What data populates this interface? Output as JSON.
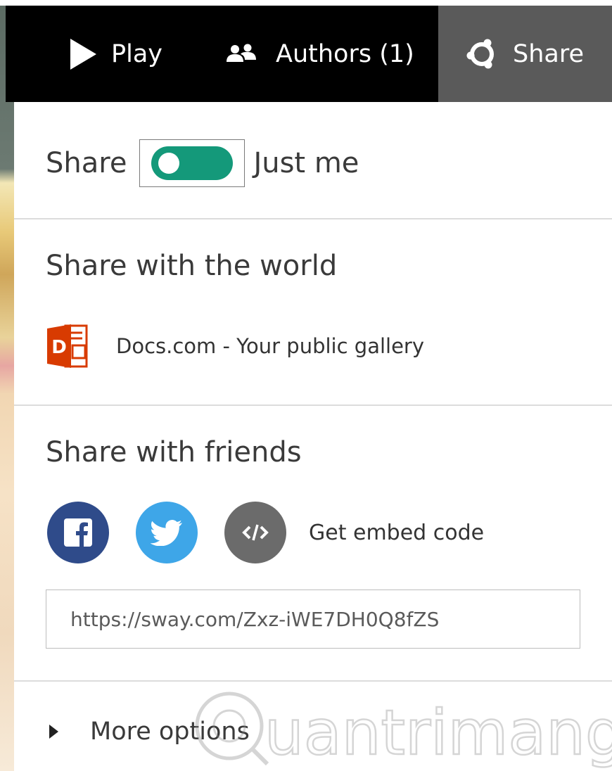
{
  "toolbar": {
    "play_label": "Play",
    "authors_label": "Authors (1)",
    "share_label": "Share"
  },
  "share_setting": {
    "label": "Share",
    "toggle_state": "off",
    "value_label": "Just me"
  },
  "world": {
    "title": "Share with the world",
    "docs_label": "Docs.com - Your public gallery"
  },
  "friends": {
    "title": "Share with friends",
    "embed_label": "Get embed code",
    "url": "https://sway.com/Zxz-iWE7DH0Q8fZS"
  },
  "more_options_label": "More options",
  "watermark_text": "uantrimang",
  "colors": {
    "toolbar_bg": "#000000",
    "share_tab_bg": "#5a5a5a",
    "toggle_green": "#14997a",
    "office_orange": "#d83b01",
    "facebook_blue": "#2f4b8a",
    "twitter_blue": "#3ea6e8",
    "embed_gray": "#6b6b6b"
  },
  "icons": {
    "play": "play-icon",
    "authors": "people-icon",
    "share": "share-icon",
    "docs": "docs-com-icon",
    "facebook": "facebook-icon",
    "twitter": "twitter-icon",
    "embed": "embed-code-icon",
    "more": "caret-right-icon"
  }
}
